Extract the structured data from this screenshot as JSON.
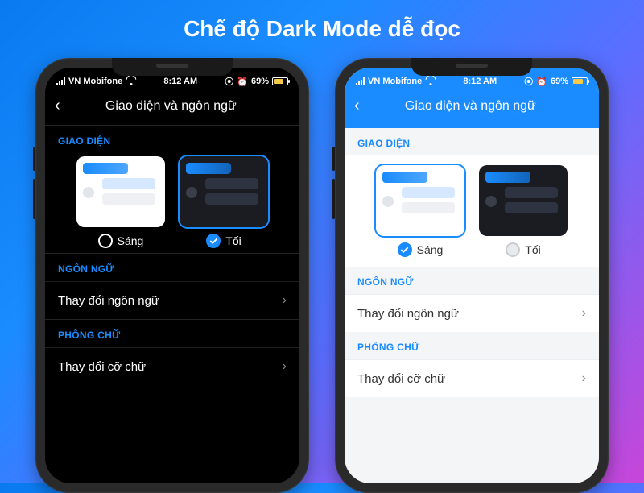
{
  "headline": "Chế độ Dark Mode dễ đọc",
  "status": {
    "carrier": "VN Mobifone",
    "time": "8:12 AM",
    "battery_pct": "69%"
  },
  "header": {
    "title": "Giao diện và ngôn ngữ"
  },
  "sections": {
    "appearance_label": "GIAO DIỆN",
    "language_label": "NGÔN NGỮ",
    "font_label": "PHÔNG CHỮ"
  },
  "theme": {
    "light_label": "Sáng",
    "dark_label": "Tối"
  },
  "rows": {
    "change_language": "Thay đổi ngôn ngữ",
    "change_font": "Thay đổi cỡ chữ"
  },
  "phones": {
    "left_selected": "dark",
    "right_selected": "light"
  }
}
